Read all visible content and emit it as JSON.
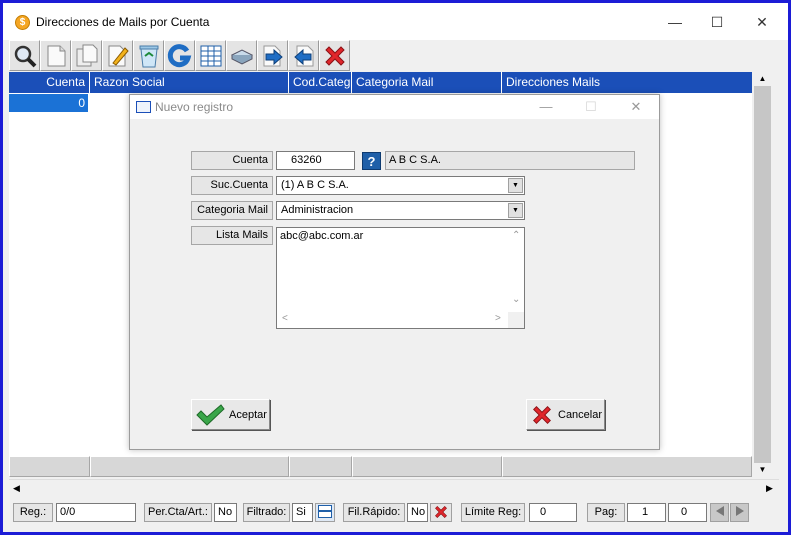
{
  "window": {
    "title": "Direcciones de Mails por Cuenta"
  },
  "toolbar": {
    "buttons": [
      {
        "icon": "search-icon"
      },
      {
        "icon": "new-doc-icon"
      },
      {
        "icon": "copy-doc-icon"
      },
      {
        "icon": "edit-icon"
      },
      {
        "icon": "recycle-bin-icon"
      },
      {
        "icon": "refresh-g-icon"
      },
      {
        "icon": "grid-view-icon"
      },
      {
        "icon": "print-icon"
      },
      {
        "icon": "export-arrow-icon"
      },
      {
        "icon": "import-arrow-icon"
      },
      {
        "icon": "close-x-icon"
      }
    ]
  },
  "grid": {
    "columns": [
      "Cuenta",
      "Razon Social",
      "Cod.Categ.",
      "Categoria Mail",
      "Direcciones Mails"
    ],
    "rows": [
      {
        "cuenta": "0"
      }
    ]
  },
  "dialog": {
    "title": "Nuevo registro",
    "cuenta_label": "Cuenta",
    "cuenta_value": "63260",
    "help_label": "?",
    "cuenta_name": "A B C  S.A.",
    "sucursal_label": "Suc.Cuenta",
    "sucursal_value": "(1) A B C  S.A.",
    "categoria_label": "Categoria Mail",
    "categoria_value": "Administracion",
    "lista_label": "Lista Mails",
    "lista_value": "abc@abc.com.ar",
    "accept_label": "Aceptar",
    "cancel_label": "Cancelar"
  },
  "statusbar": {
    "reg_label": "Reg.:",
    "reg_value": "0/0",
    "percta_label": "Per.Cta/Art.:",
    "percta_value": "No",
    "filtrado_label": "Filtrado:",
    "filtrado_value": "Si",
    "filrapido_label": "Fil.Rápido:",
    "filrapido_value": "No",
    "limite_label": "Límite Reg:",
    "limite_value": "0",
    "pag_label": "Pag:",
    "pag_value": "1",
    "pag_total": "0"
  },
  "colors": {
    "header_blue": "#1b4fb8",
    "selection_blue": "#1b72d6",
    "frame_blue": "#1c1cd6",
    "cancel_red": "#e0262b",
    "accept_green": "#3aa64a"
  }
}
